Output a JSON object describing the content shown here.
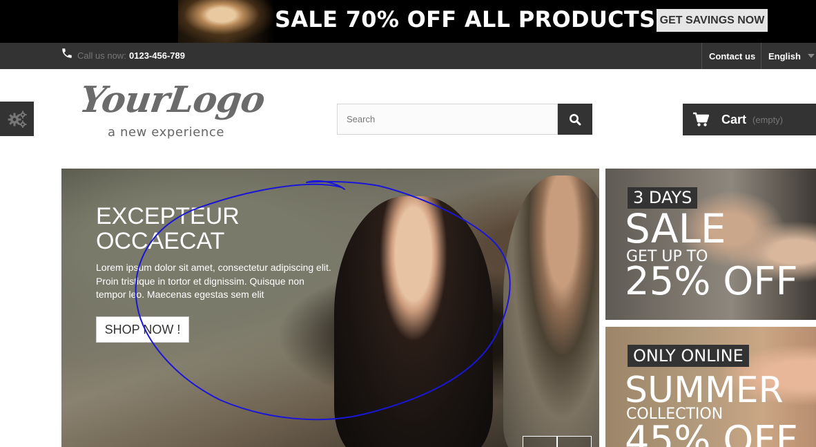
{
  "promo": {
    "text": "SALE 70% OFF ALL PRODUCTS",
    "button": "GET SAVINGS NOW"
  },
  "navbar": {
    "call_label": "Call us now:",
    "phone": "0123-456-789",
    "contact": "Contact us",
    "language": "English"
  },
  "logo": {
    "main": "YourLogo",
    "tagline": "a new experience"
  },
  "search": {
    "placeholder": "Search",
    "value": ""
  },
  "cart": {
    "label": "Cart",
    "status": "(empty)"
  },
  "hero": {
    "title": "EXCEPTEUR OCCAECAT",
    "text": "Lorem ipsum dolor sit amet, consectetur adipiscing elit. Proin tristique in tortor et dignissim. Quisque non tempor leo. Maecenas egestas sem elit",
    "button": "SHOP NOW !"
  },
  "banner_sale": {
    "tag": "3 DAYS",
    "headline": "SALE",
    "sub": "GET UP TO",
    "discount": "25% OFF"
  },
  "banner_summer": {
    "tag": "ONLY ONLINE",
    "headline": "SUMMER",
    "sub": "COLLECTION",
    "discount": "45% OFF"
  },
  "colors": {
    "dark": "#333333",
    "annotation_stroke": "#1a16d8"
  }
}
